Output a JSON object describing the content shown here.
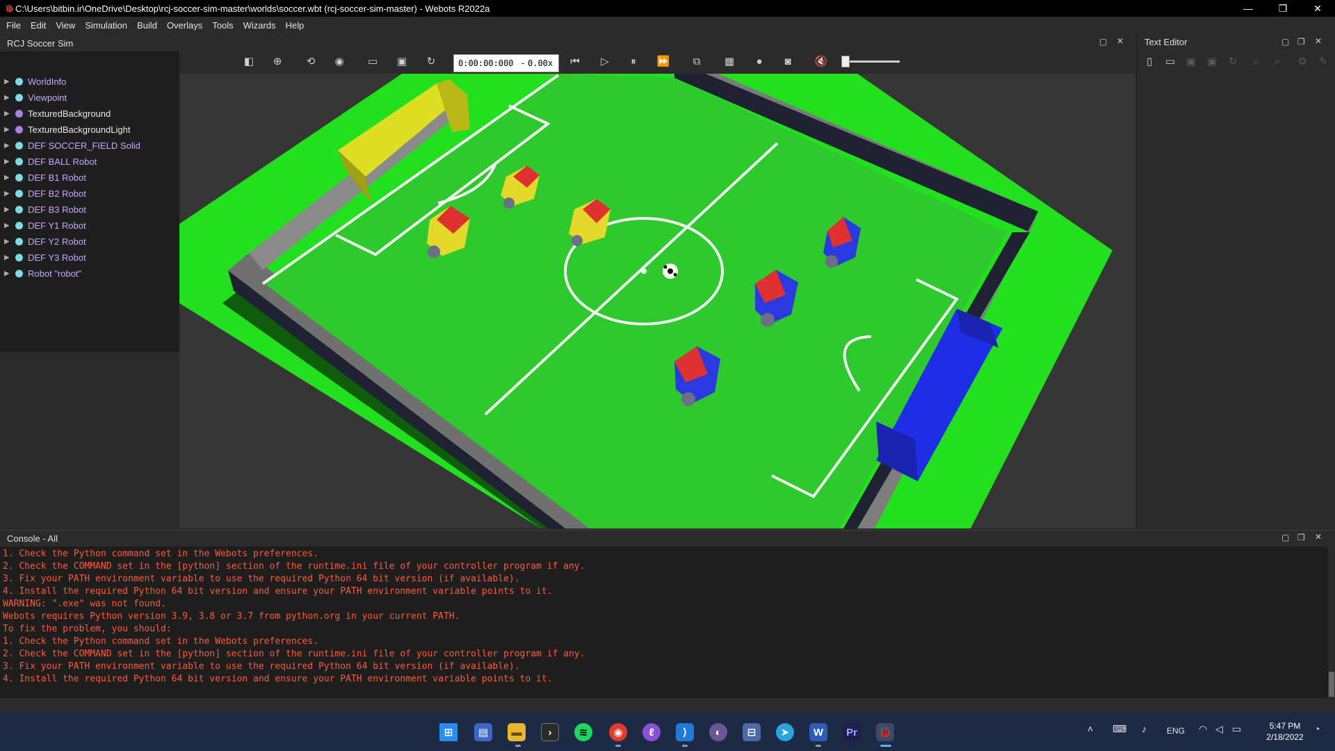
{
  "window": {
    "title": "C:\\Users\\bitbin.ir\\OneDrive\\Desktop\\rcj-soccer-sim-master\\worlds\\soccer.wbt (rcj-soccer-sim-master) - Webots R2022a",
    "minimize": "—",
    "maximize": "❐",
    "close": "✕"
  },
  "menu": [
    "File",
    "Edit",
    "View",
    "Simulation",
    "Build",
    "Overlays",
    "Tools",
    "Wizards",
    "Help"
  ],
  "scene_panel": {
    "title": "RCJ Soccer Sim",
    "items": [
      {
        "label": "WorldInfo",
        "color": "#7fd8e6",
        "text_color": "purple"
      },
      {
        "label": "Viewpoint",
        "color": "#7fd8e6",
        "text_color": "purple"
      },
      {
        "label": "TexturedBackground",
        "color": "#b07fe0",
        "text_color": "white"
      },
      {
        "label": "TexturedBackgroundLight",
        "color": "#b07fe0",
        "text_color": "white"
      },
      {
        "label": "DEF SOCCER_FIELD Solid",
        "color": "#7fd8e6",
        "text_color": "purple"
      },
      {
        "label": "DEF BALL Robot",
        "color": "#7fd8e6",
        "text_color": "purple"
      },
      {
        "label": "DEF B1 Robot",
        "color": "#7fd8e6",
        "text_color": "purple"
      },
      {
        "label": "DEF B2 Robot",
        "color": "#7fd8e6",
        "text_color": "purple"
      },
      {
        "label": "DEF B3 Robot",
        "color": "#7fd8e6",
        "text_color": "purple"
      },
      {
        "label": "DEF Y1 Robot",
        "color": "#7fd8e6",
        "text_color": "purple"
      },
      {
        "label": "DEF Y2 Robot",
        "color": "#7fd8e6",
        "text_color": "purple"
      },
      {
        "label": "DEF Y3 Robot",
        "color": "#7fd8e6",
        "text_color": "purple"
      },
      {
        "label": "Robot \"robot\"",
        "color": "#7fd8e6",
        "text_color": "purple"
      }
    ]
  },
  "sim_toolbar": {
    "time": "0:00:00:000",
    "separator": "-",
    "speed": "0.00x"
  },
  "text_editor": {
    "title": "Text Editor"
  },
  "console": {
    "title": "Console - All",
    "lines": [
      "1. Check the Python command set in the Webots preferences.",
      "2. Check the COMMAND set in the [python] section of the runtime.ini file of your controller program if any.",
      "3. Fix your PATH environment variable to use the required Python 64 bit version (if available).",
      "4. Install the required Python 64 bit version and ensure your PATH environment variable points to it.",
      "WARNING: \".exe\" was not found.",
      "Webots requires Python version 3.9, 3.8 or 3.7 from python.org in your current PATH.",
      "To fix the problem, you should:",
      "1. Check the Python command set in the Webots preferences.",
      "2. Check the COMMAND set in the [python] section of the runtime.ini file of your controller program if any.",
      "3. Fix your PATH environment variable to use the required Python 64 bit version (if available).",
      "4. Install the required Python 64 bit version and ensure your PATH environment variable points to it."
    ]
  },
  "taskbar": {
    "language": "ENG",
    "time": "5:47 PM",
    "date": "2/18/2022"
  }
}
